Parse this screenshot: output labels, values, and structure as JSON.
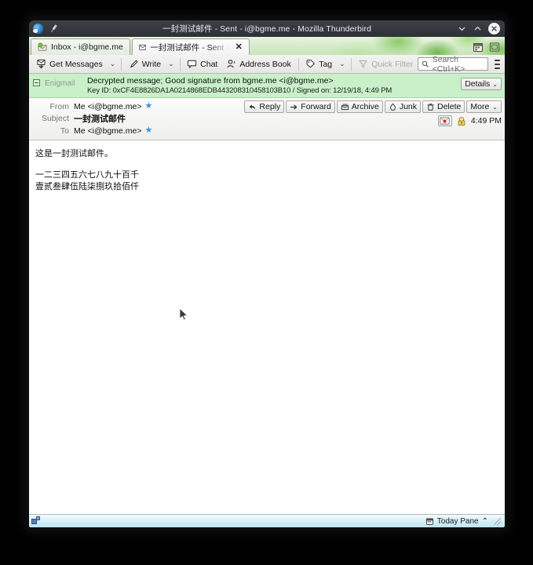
{
  "window": {
    "title": "一封测试邮件 - Sent - i@bgme.me - Mozilla Thunderbird",
    "app_icon": "thunderbird-icon",
    "pin_icon": "pin-icon",
    "minimize_label": "minimize-icon",
    "maximize_label": "maximize-icon",
    "close_label": "close-icon"
  },
  "tabs": [
    {
      "label": "Inbox - i@bgme.me",
      "icon": "inbox-icon",
      "active": false,
      "closable": false
    },
    {
      "label": "一封测试邮件 - Sent - i@bg",
      "icon": "envelope-icon",
      "active": true,
      "closable": true,
      "close_glyph": "✕"
    }
  ],
  "tabbar_icons": [
    {
      "name": "calendar-events-icon"
    },
    {
      "name": "tab-list-icon"
    }
  ],
  "toolbar": {
    "get_messages": "Get Messages",
    "write": "Write",
    "chat": "Chat",
    "address_book": "Address Book",
    "tag": "Tag",
    "quick_filter": "Quick Filter",
    "dropdown_glyph": "⌄",
    "menu_icon": "hamburger-menu-icon"
  },
  "search": {
    "placeholder": "Search <Ctrl+K>",
    "value": "",
    "icon": "search-icon"
  },
  "enigmail": {
    "name": "Enigmail",
    "toggle_icon": "collapse-box-icon",
    "line1": "Decrypted message; Good signature from bgme.me <i@bgme.me>",
    "line2": "Key ID: 0xCF4E8826DA1A0214868EDB443208310458103B10 / Signed on: 12/19/18, 4:49 PM",
    "details_label": "Details",
    "details_caret": "⌄",
    "background_color": "#c9f0c9"
  },
  "message": {
    "from_label": "From",
    "from_value": "Me <i@bgme.me>",
    "subject_label": "Subject",
    "subject_value": "一封测试邮件",
    "to_label": "To",
    "to_value": "Me <i@bgme.me>",
    "star_glyph": "★",
    "time": "4:49 PM",
    "encryption_icon": "encrypted-envelope-icon",
    "lock_icon": "lock-icon",
    "actions": [
      {
        "label": "Reply",
        "icon": "reply-icon"
      },
      {
        "label": "Forward",
        "icon": "forward-icon"
      },
      {
        "label": "Archive",
        "icon": "archive-icon"
      },
      {
        "label": "Junk",
        "icon": "junk-icon"
      },
      {
        "label": "Delete",
        "icon": "trash-icon"
      },
      {
        "label": "More",
        "icon": "chevron-down-icon",
        "caret": "⌄"
      }
    ],
    "body": [
      "这是一封测试邮件。",
      "",
      "一二三四五六七八九十百千",
      "壹贰叁肆伍陆柒捌玖拾佰仟"
    ]
  },
  "statusbar": {
    "left_icon": "offline-status-icon",
    "today_pane_label": "Today Pane",
    "today_pane_icon": "calendar-icon",
    "today_pane_caret": "⌃"
  },
  "colors": {
    "accent_green": "#c9f0c9",
    "star_blue": "#3b8fd6",
    "titlebar": "#34383d",
    "statusbar": "#d3eef7"
  }
}
